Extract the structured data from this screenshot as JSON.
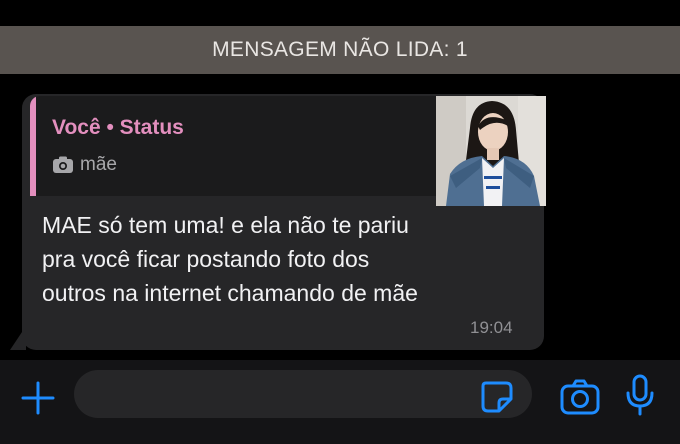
{
  "unread_banner": {
    "text": "MENSAGEM NÃO LIDA: 1"
  },
  "message": {
    "quoted": {
      "author": "Você • Status",
      "media_label": "mãe",
      "media_icon": "camera-icon",
      "accent_color": "#e38fbe"
    },
    "lines": [
      "MAE só tem uma! e ela não te pariu",
      "pra você ficar postando foto dos",
      "outros na internet chamando de mãe"
    ],
    "time": "19:04"
  },
  "input_bar": {
    "accent_color": "#1e8cff",
    "icons": [
      "plus-icon",
      "sticker-icon",
      "camera-icon",
      "microphone-icon"
    ]
  }
}
